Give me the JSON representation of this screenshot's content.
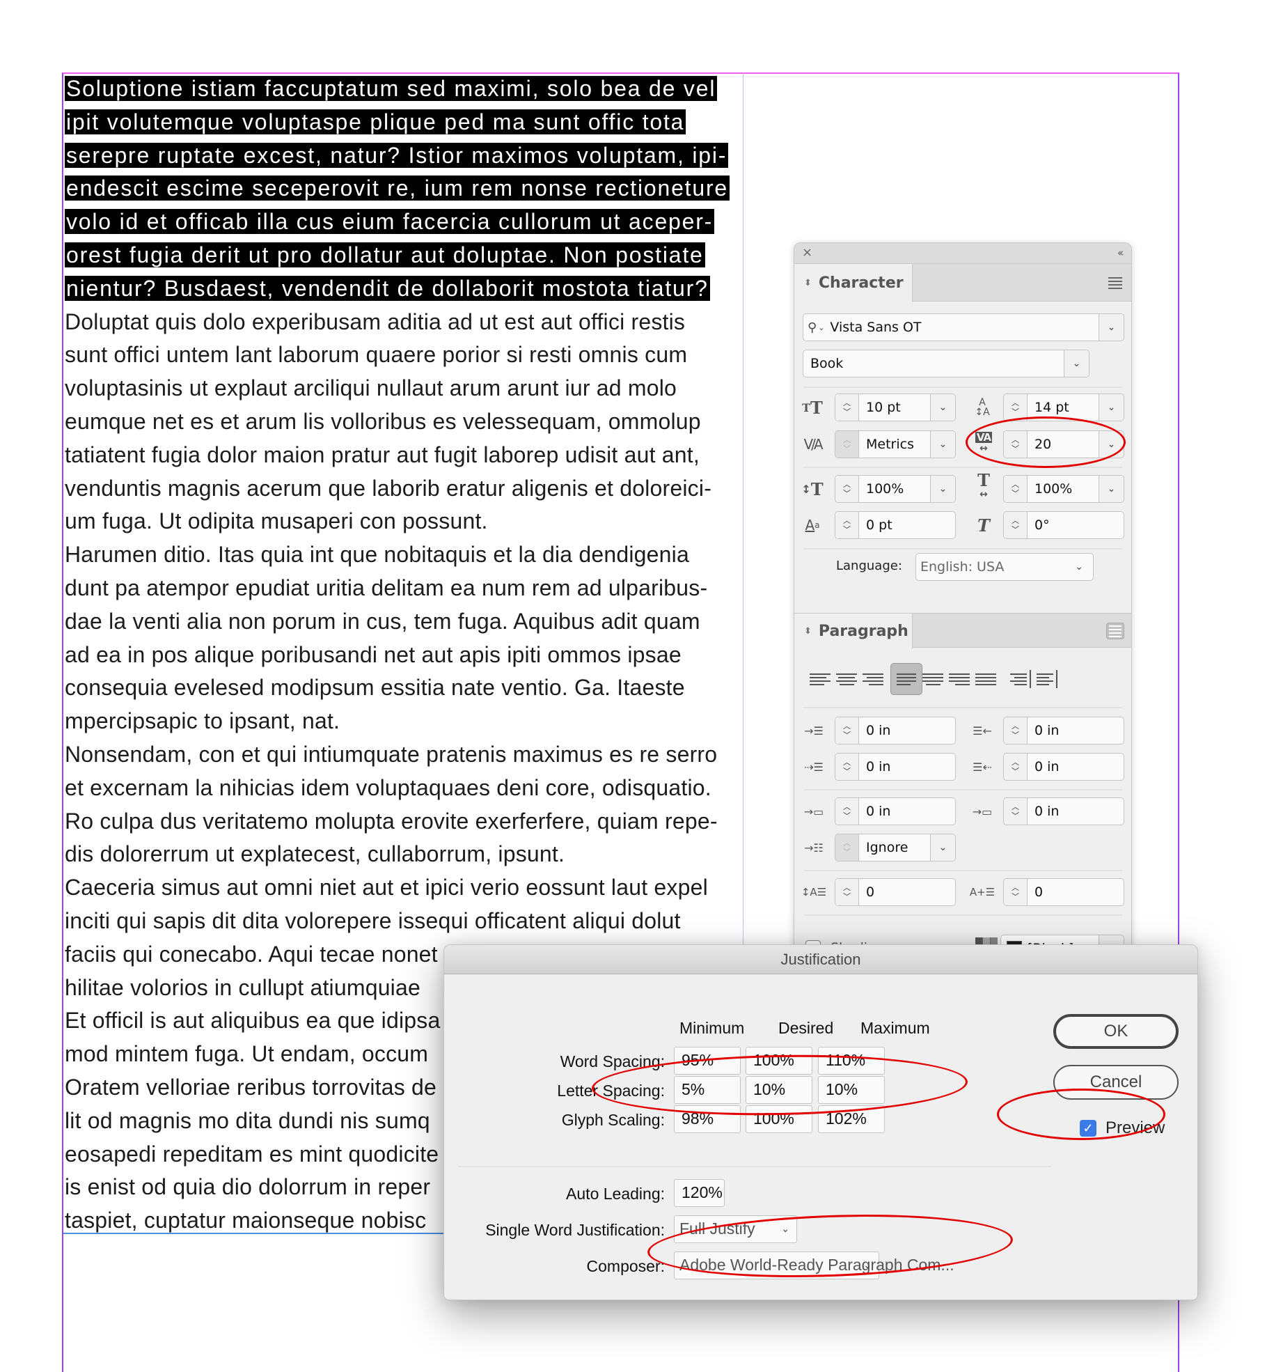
{
  "document": {
    "highlighted_lines": [
      "Soluptione istiam faccuptatum sed maximi, solo bea de vel",
      "ipit volutemque voluptaspe plique ped ma sunt offic tota",
      "serepre ruptate excest, natur? Istior maximos voluptam, ipi-",
      "endescit escime seceperovit re, ium rem nonse rectioneture",
      "volo id et officab illa cus eium facercia cullorum ut aceper-",
      "orest fugia derit ut pro dollatur aut doluptae. Non postiate",
      "nientur? Busdaest, vendendit de dollaborit mostota tiatur?"
    ],
    "body_lines": [
      "Doluptat quis dolo experibusam aditia ad ut est aut offici restis",
      "sunt offici untem lant laborum quaere porior si resti omnis cum",
      "voluptasinis ut explaut arciliqui nullaut arum arunt iur ad molo",
      "eumque net es et arum lis volloribus es velessequam, ommolup",
      "tatiatent fugia dolor maion pratur aut fugit laborep udisit aut ant,",
      "venduntis magnis acerum que laborib eratur aligenis et doloreici-",
      "um fuga. Ut odipita musaperi con possunt.",
      "Harumen ditio. Itas quia int que nobitaquis et la dia dendigenia",
      "dunt pa atempor epudiat uritia delitam ea num rem ad ulparibus-",
      "dae la venti alia non porum in cus, tem fuga. Aquibus adit quam",
      "ad ea in pos alique poribusandi net aut apis ipiti ommos ipsae",
      "consequia evelesed modipsum essitia nate ventio. Ga. Itaeste",
      "mpercipsapic to ipsant, nat.",
      "Nonsendam, con et qui intiumquate pratenis maximus es re serro",
      "et excernam la nihicias idem voluptaquaes deni core, odisquatio.",
      "Ro culpa dus veritatemo molupta erovite exerferfere, quiam repe-",
      "dis dolorerrum ut explatecest, cullaborrum, ipsunt.",
      "Caeceria simus aut omni niet aut et ipici verio eossunt laut expel",
      "inciti qui sapis dit dita volorepere issequi officatent aliqui dolut",
      "faciis qui conecabo. Aqui tecae nonet eturian dendit vitate vellum",
      "hilitae volorios in cullupt atiumquiae",
      "Et officil is aut aliquibus ea que idipsa",
      "mod mintem fuga. Ut endam, occum",
      "Oratem velloriae reribus torrovitas de",
      "lit od magnis mo dita dundi nis sumq",
      "eosapedi repeditam es mint quodicite",
      "is enist od quia dio dolorrum in reper",
      "taspiet, cuptatur maionseque nobisc"
    ]
  },
  "character_panel": {
    "close_icon": "×",
    "collapse_icon": "‹‹",
    "tab_label": "Character",
    "font_family": "Vista Sans OT",
    "font_style": "Book",
    "font_size": "10 pt",
    "leading": "14 pt",
    "kerning": "Metrics",
    "tracking": "20",
    "vertical_scale": "100%",
    "horizontal_scale": "100%",
    "baseline_shift": "0 pt",
    "skew": "0°",
    "language_label": "Language:",
    "language": "English: USA"
  },
  "paragraph_panel": {
    "tab_label": "Paragraph",
    "alignment_options": [
      "align-left",
      "align-center",
      "align-right",
      "justify-last-left",
      "justify-last-center",
      "justify-last-right",
      "justify-all",
      "align-towards-spine",
      "align-away-from-spine"
    ],
    "selected_alignment": "justify-last-left",
    "left_indent": "0 in",
    "right_indent": "0 in",
    "first_line_indent": "0 in",
    "last_line_indent": "0 in",
    "space_before": "0 in",
    "space_after": "0 in",
    "align_to_grid": "Ignore",
    "drop_cap_lines": "0",
    "drop_cap_chars": "0",
    "shading_label": "Shading",
    "shading_checked": false,
    "shading_color": "[Black]"
  },
  "justification_dialog": {
    "title": "Justification",
    "columns": [
      "Minimum",
      "Desired",
      "Maximum"
    ],
    "rows": [
      {
        "label": "Word Spacing:",
        "values": [
          "95%",
          "100%",
          "110%"
        ]
      },
      {
        "label": "Letter Spacing:",
        "values": [
          "5%",
          "10%",
          "10%"
        ]
      },
      {
        "label": "Glyph Scaling:",
        "values": [
          "98%",
          "100%",
          "102%"
        ]
      }
    ],
    "auto_leading_label": "Auto Leading:",
    "auto_leading": "120%",
    "single_word_label": "Single Word Justification:",
    "single_word": "Full Justify",
    "composer_label": "Composer:",
    "composer": "Adobe World-Ready Paragraph Com...",
    "ok_label": "OK",
    "cancel_label": "Cancel",
    "preview_label": "Preview",
    "preview_checked": true
  },
  "annotation_color": "#e30000"
}
